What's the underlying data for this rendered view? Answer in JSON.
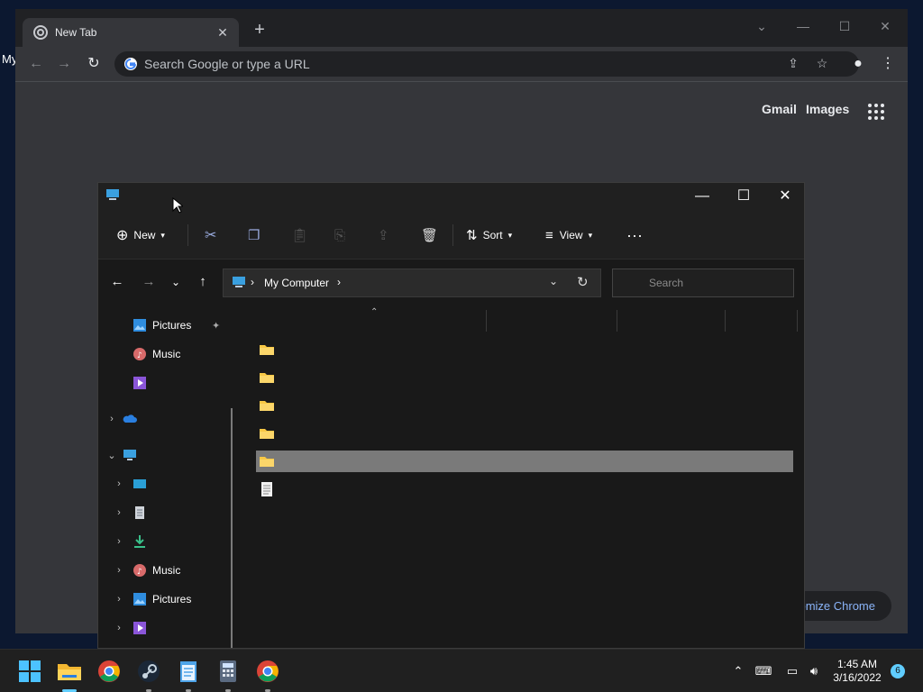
{
  "desktop": {
    "partial_text": "My"
  },
  "chrome": {
    "tab_title": "New Tab",
    "omnibox_placeholder": "Search Google or type a URL",
    "links": {
      "gmail": "Gmail",
      "images": "Images"
    },
    "customize": "omize Chrome",
    "icons": [
      "chrome-icon",
      "close-icon",
      "plus-icon",
      "back-icon",
      "forward-icon",
      "reload-icon",
      "google-icon",
      "share-icon",
      "star-icon",
      "profile-icon",
      "menu-icon",
      "apps-icon"
    ]
  },
  "explorer": {
    "commands": {
      "new": "New",
      "sort": "Sort",
      "view": "View"
    },
    "address": {
      "location": "My Computer"
    },
    "search_placeholder": "Search",
    "sidebar": [
      {
        "label": "Pictures",
        "icon": "pictures-icon",
        "pinned": true
      },
      {
        "label": "Music",
        "icon": "music-icon"
      },
      {
        "label": "",
        "icon": "videos-icon"
      },
      {
        "label": "",
        "icon": "onedrive-icon",
        "expandable": true
      },
      {
        "label": "",
        "icon": "this-pc-icon",
        "expanded": true
      },
      {
        "label": "",
        "icon": "desktop-icon"
      },
      {
        "label": "",
        "icon": "documents-icon"
      },
      {
        "label": "",
        "icon": "downloads-icon"
      },
      {
        "label": "Music",
        "icon": "music-icon"
      },
      {
        "label": "Pictures",
        "icon": "pictures-icon"
      },
      {
        "label": "",
        "icon": "videos-icon"
      }
    ],
    "rows": [
      {
        "type": "folder",
        "selected": false
      },
      {
        "type": "folder",
        "selected": false
      },
      {
        "type": "folder",
        "selected": false
      },
      {
        "type": "folder",
        "selected": false
      },
      {
        "type": "folder",
        "selected": true
      },
      {
        "type": "file",
        "selected": false
      }
    ]
  },
  "taskbar": {
    "apps": [
      "start-icon",
      "file-explorer-icon",
      "chrome-icon",
      "steam-icon",
      "notepad-icon",
      "calculator-icon",
      "chrome-icon"
    ],
    "time": "1:45 AM",
    "date": "3/16/2022",
    "notification_count": "6"
  },
  "colors": {
    "accent": "#60cdff",
    "folder": "#f8c845",
    "chrome_dark": "#202124",
    "selection": "#7a7a7a"
  }
}
